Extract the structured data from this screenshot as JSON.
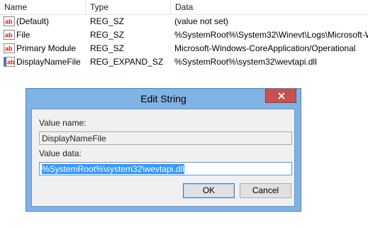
{
  "list": {
    "columns": {
      "name": "Name",
      "type": "Type",
      "data": "Data"
    },
    "rows": [
      {
        "name": "(Default)",
        "type": "REG_SZ",
        "data": "(value not set)",
        "icon": "string-value-icon"
      },
      {
        "name": "File",
        "type": "REG_SZ",
        "data": "%SystemRoot%\\System32\\Winevt\\Logs\\Microsoft-W",
        "icon": "string-value-icon"
      },
      {
        "name": "Primary Module",
        "type": "REG_SZ",
        "data": "Microsoft-Windows-CoreApplication/Operational",
        "icon": "string-value-icon"
      },
      {
        "name": "DisplayNameFile",
        "type": "REG_EXPAND_SZ",
        "data": "%SystemRoot%\\system32\\wevtapi.dll",
        "icon": "string-value-icon"
      }
    ]
  },
  "dialog": {
    "title": "Edit String",
    "value_name_label": "Value name:",
    "value_name": "DisplayNameFile",
    "value_data_label": "Value data:",
    "value_data": "%SystemRoot%\\system32\\wevtapi.dll",
    "ok_label": "OK",
    "cancel_label": "Cancel",
    "close_icon": "close-icon"
  },
  "colors": {
    "dialog_frame": "#7fb2e5",
    "close_button": "#c75050",
    "selection": "#3399ff",
    "icon_red": "#c4261d",
    "icon_blue": "#3b6fcc"
  }
}
